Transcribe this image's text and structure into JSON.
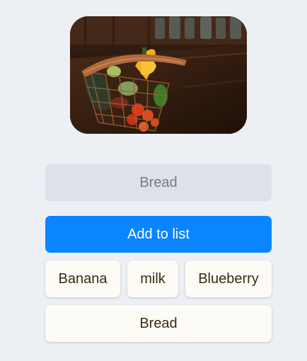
{
  "hero_image": {
    "icon": "grocery-basket-photo"
  },
  "item_input": {
    "value": "",
    "placeholder": "Bread"
  },
  "add_button": {
    "label": "Add to list",
    "color": "#0a84ff"
  },
  "list": {
    "items": [
      {
        "label": "Banana"
      },
      {
        "label": "milk"
      },
      {
        "label": "Blueberry"
      },
      {
        "label": "Bread"
      }
    ]
  }
}
